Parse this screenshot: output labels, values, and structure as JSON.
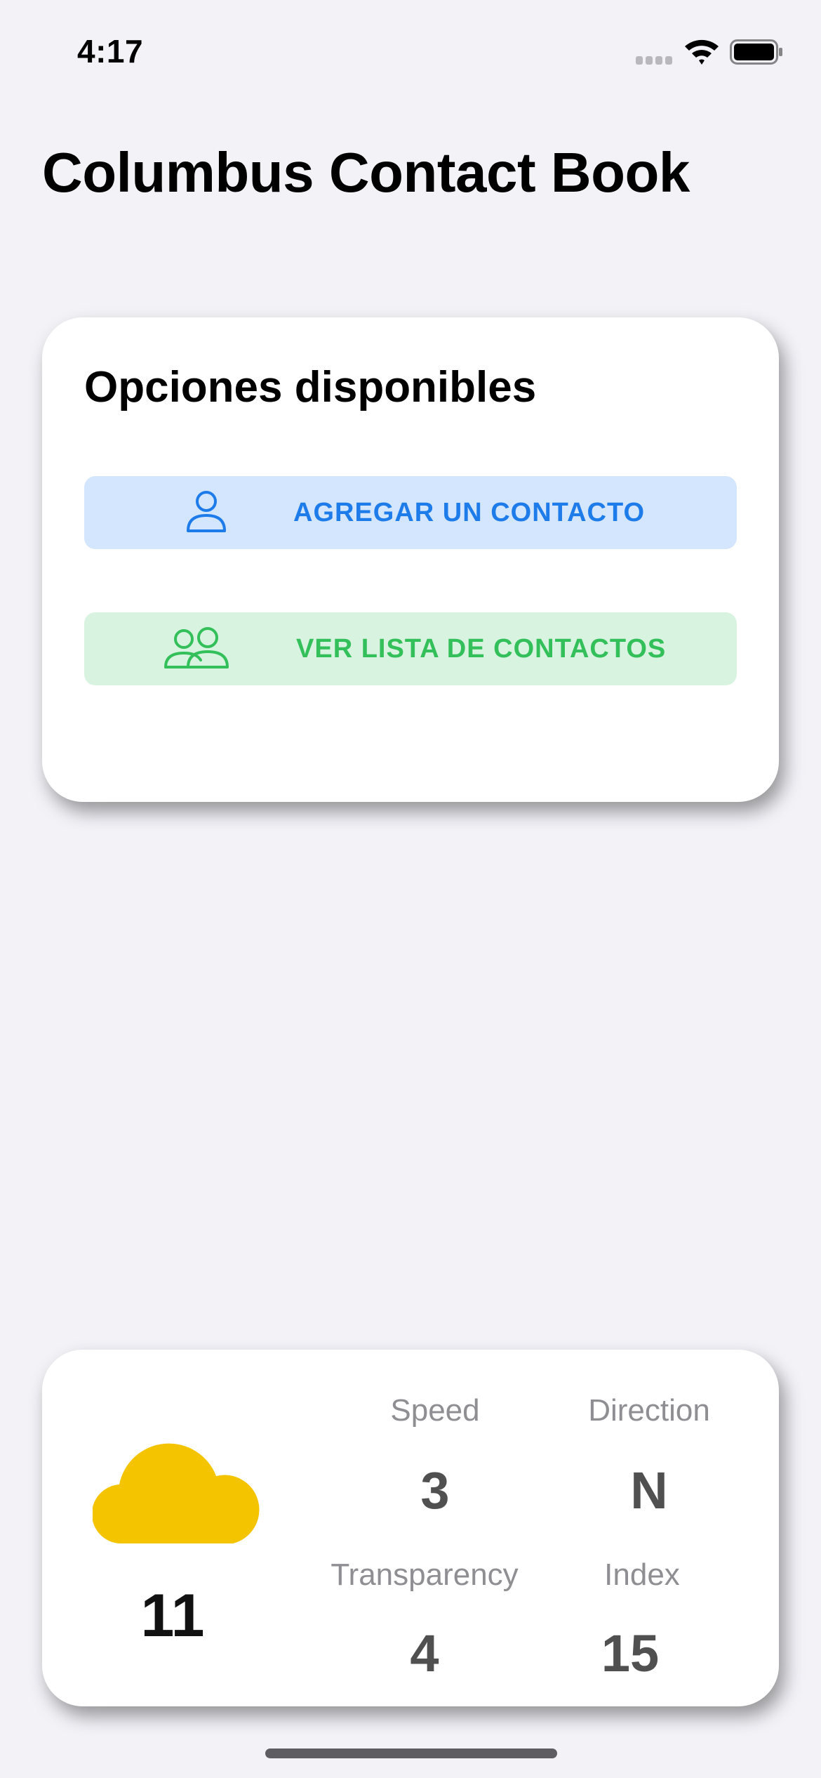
{
  "status_bar": {
    "time": "4:17"
  },
  "header": {
    "title": "Columbus Contact Book"
  },
  "options_card": {
    "title": "Opciones disponibles",
    "add_contact": {
      "label": "AGREGAR UN CONTACTO",
      "icon": "person-icon",
      "color": "#1E7BEA",
      "background": "#D3E6FD"
    },
    "view_contacts": {
      "label": "VER LISTA DE CONTACTOS",
      "icon": "people-icon",
      "color": "#33C05A",
      "background": "#D8F3DF"
    }
  },
  "weather_card": {
    "icon": "cloud-icon",
    "icon_color": "#F5C400",
    "value": "11",
    "stats": {
      "speed": {
        "label": "Speed",
        "value": "3"
      },
      "direction": {
        "label": "Direction",
        "value": "N"
      },
      "transparency": {
        "label": "Transparency",
        "value": "4"
      },
      "index": {
        "label": "Index",
        "value": "15"
      }
    }
  }
}
